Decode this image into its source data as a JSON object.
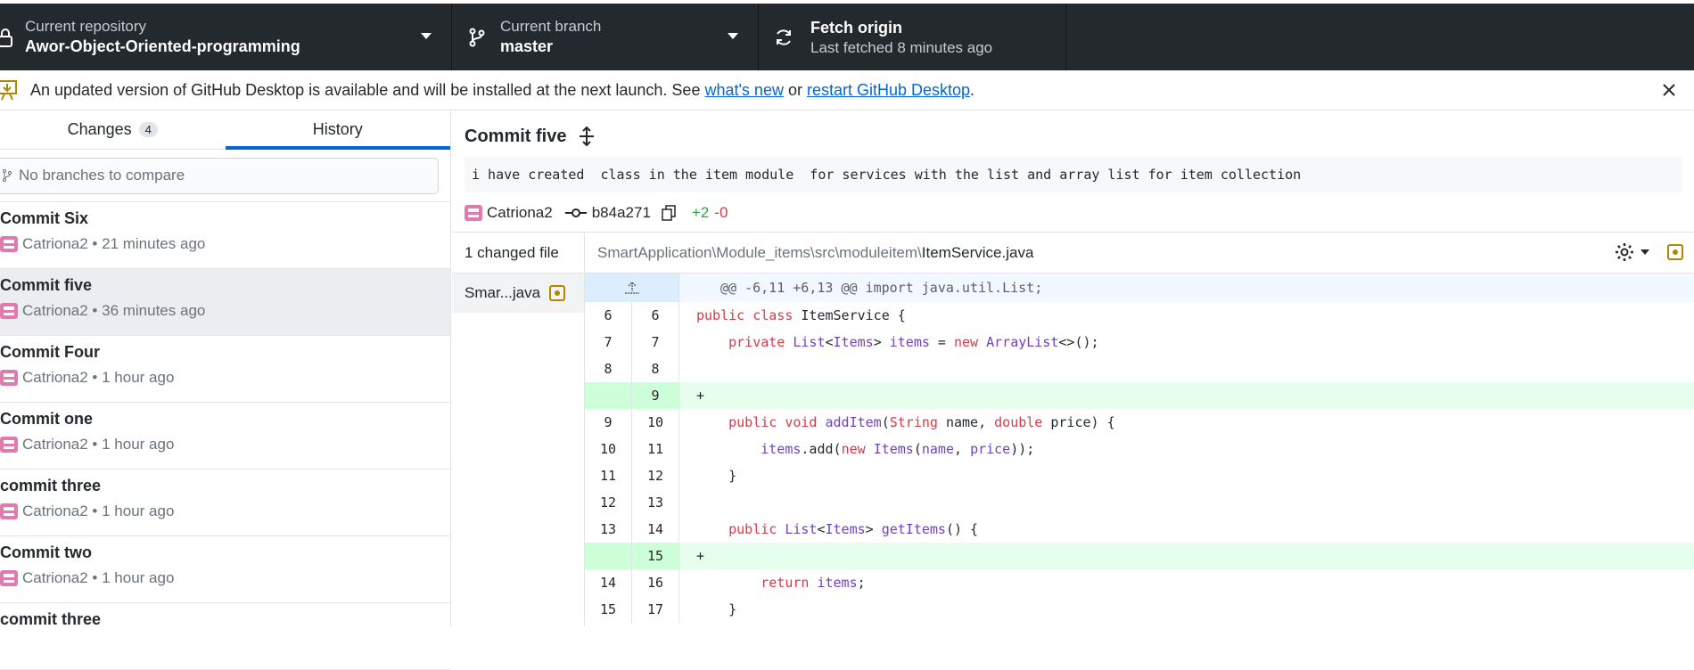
{
  "toolbar": {
    "repo_label": "Current repository",
    "repo_value": "Awor-Object-Oriented-programming",
    "branch_label": "Current branch",
    "branch_value": "master",
    "fetch_label": "Fetch origin",
    "fetch_sub": "Last fetched 8 minutes ago"
  },
  "banner": {
    "text_before": "An updated version of GitHub Desktop is available and will be installed at the next launch. See ",
    "link1": "what's new",
    "text_mid": " or ",
    "link2": "restart GitHub Desktop",
    "text_after": "."
  },
  "sidebar": {
    "tab_changes": "Changes",
    "changes_count": "4",
    "tab_history": "History",
    "compare_placeholder": "No branches to compare",
    "commits": [
      {
        "title": "Commit Six",
        "meta": "Catriona2 • 21 minutes ago"
      },
      {
        "title": "Commit five",
        "meta": "Catriona2 • 36 minutes ago"
      },
      {
        "title": "Commit Four",
        "meta": "Catriona2 • 1 hour ago"
      },
      {
        "title": "Commit one",
        "meta": "Catriona2 • 1 hour ago"
      },
      {
        "title": "commit three",
        "meta": "Catriona2 • 1 hour ago"
      },
      {
        "title": "Commit two",
        "meta": "Catriona2 • 1 hour ago"
      },
      {
        "title": "commit three",
        "meta": ""
      }
    ]
  },
  "commit": {
    "title": "Commit five",
    "description": "i have created  class in the item module  for services with the list and array list for item collection",
    "author": "Catriona2",
    "sha": "b84a271",
    "additions": "+2",
    "deletions": "-0"
  },
  "files": {
    "header": "1 changed file",
    "items": [
      {
        "name": "Smar...java"
      }
    ]
  },
  "diff": {
    "path_prefix": "SmartApplication\\Module_items\\src\\moduleitem\\",
    "path_file": "ItemService.java",
    "hunk": "@@ -6,11 +6,13 @@ import java.util.List;",
    "lines": [
      {
        "old": "6",
        "new": "6",
        "type": "ctx"
      },
      {
        "old": "7",
        "new": "7",
        "type": "ctx"
      },
      {
        "old": "8",
        "new": "8",
        "type": "ctx"
      },
      {
        "old": "",
        "new": "9",
        "type": "add"
      },
      {
        "old": "9",
        "new": "10",
        "type": "ctx"
      },
      {
        "old": "10",
        "new": "11",
        "type": "ctx"
      },
      {
        "old": "11",
        "new": "12",
        "type": "ctx"
      },
      {
        "old": "12",
        "new": "13",
        "type": "ctx"
      },
      {
        "old": "13",
        "new": "14",
        "type": "ctx"
      },
      {
        "old": "",
        "new": "15",
        "type": "add"
      },
      {
        "old": "14",
        "new": "16",
        "type": "ctx"
      },
      {
        "old": "15",
        "new": "17",
        "type": "ctx"
      }
    ],
    "code": {
      "l1_a": "public class ",
      "l1_b": "ItemService {",
      "l2_a": "    private ",
      "l2_b": "List",
      "l2_c": "<",
      "l2_d": "Items",
      "l2_e": "> ",
      "l2_f": "items",
      "l2_g": " = ",
      "l2_h": "new ",
      "l2_i": "ArrayList",
      "l2_j": "<>();",
      "l4": "+",
      "l5_a": "    public void ",
      "l5_b": "addItem",
      "l5_c": "(",
      "l5_d": "String",
      "l5_e": " name, ",
      "l5_f": "double",
      "l5_g": " price) {",
      "l6_a": "        items",
      "l6_b": ".add(",
      "l6_c": "new ",
      "l6_d": "Items",
      "l6_e": "(",
      "l6_f": "name",
      "l6_g": ", ",
      "l6_h": "price",
      "l6_i": "));",
      "l7": "    }",
      "l9_a": "    public ",
      "l9_b": "List",
      "l9_c": "<",
      "l9_d": "Items",
      "l9_e": "> ",
      "l9_f": "getItems",
      "l9_g": "() {",
      "l10": "+",
      "l11_a": "        return ",
      "l11_b": "items",
      "l11_c": ";",
      "l12": "    }"
    }
  }
}
